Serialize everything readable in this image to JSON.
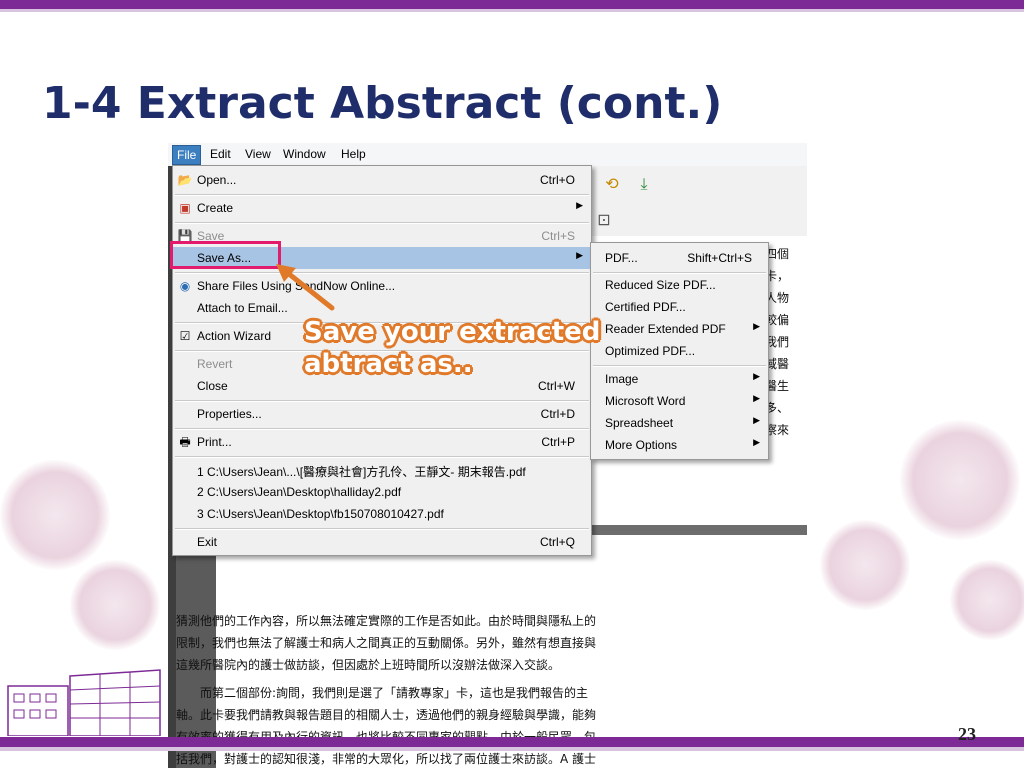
{
  "slide": {
    "title": "1-4 Extract Abstract (cont.)",
    "page_number": "23"
  },
  "menubar": {
    "items": [
      "File",
      "Edit",
      "View",
      "Window",
      "Help"
    ]
  },
  "file_menu": {
    "open": {
      "label": "Open...",
      "shortcut": "Ctrl+O"
    },
    "create": {
      "label": "Create"
    },
    "save": {
      "label": "Save",
      "shortcut": "Ctrl+S"
    },
    "save_as": {
      "label": "Save As..."
    },
    "share": {
      "label": "Share Files Using SendNow Online..."
    },
    "attach": {
      "label": "Attach to Email..."
    },
    "action_wizard": {
      "label": "Action Wizard"
    },
    "revert": {
      "label": "Revert"
    },
    "close": {
      "label": "Close",
      "shortcut": "Ctrl+W"
    },
    "properties": {
      "label": "Properties...",
      "shortcut": "Ctrl+D"
    },
    "print": {
      "label": "Print...",
      "shortcut": "Ctrl+P"
    },
    "recent": [
      "1 C:\\Users\\Jean\\...\\[醫療與社會]方孔伶、王靜文- 期末報告.pdf",
      "2 C:\\Users\\Jean\\Desktop\\halliday2.pdf",
      "3 C:\\Users\\Jean\\Desktop\\fb150708010427.pdf"
    ],
    "exit": {
      "label": "Exit",
      "shortcut": "Ctrl+Q"
    }
  },
  "save_as_submenu": {
    "pdf": {
      "label": "PDF...",
      "shortcut": "Shift+Ctrl+S"
    },
    "reduced": {
      "label": "Reduced Size PDF..."
    },
    "certified": {
      "label": "Certified PDF..."
    },
    "reader_extended": {
      "label": "Reader Extended PDF"
    },
    "optimized": {
      "label": "Optimized PDF..."
    },
    "image": {
      "label": "Image"
    },
    "word": {
      "label": "Microsoft Word"
    },
    "spreadsheet": {
      "label": "Spreadsheet"
    },
    "more": {
      "label": "More Options"
    }
  },
  "callout": {
    "line1": "Save your extracted",
    "line2": "abtract as.."
  },
  "document": {
    "side_fragments": [
      "四個",
      "卡，",
      "人物",
      "較偏",
      "我們",
      "域醫",
      "醫生",
      "多、",
      "察來"
    ],
    "paragraph1": [
      "猜測他們的工作內容，所以無法確定實際的工作是否如此。由於時間與隱私上的",
      "限制，我們也無法了解護士和病人之間真正的互動關係。另外，雖然有想直接與",
      "這幾所醫院內的護士做訪談，但因處於上班時間所以沒辦法做深入交談。"
    ],
    "paragraph2": [
      "而第二個部份:詢問，我們則是選了「請教專家」卡，這也是我們報告的主",
      "軸。此卡要我們請教與報告題目的相關人士，透過他們的親身經驗與學識，能夠",
      "有效率的獲得有用及內行的資訊，也將比較不同專家的觀點。由於一般民眾，包",
      "括我們，對護士的認知很淺，非常的大眾化，所以找了兩位護士來訪談。A 護士"
    ]
  },
  "colors": {
    "brand_purple": "#7d2a96",
    "title_navy": "#1f2d6b",
    "highlight_box": "#e31b6d",
    "callout_orange": "#e07a2a",
    "menu_highlight": "#a8c4e4"
  }
}
